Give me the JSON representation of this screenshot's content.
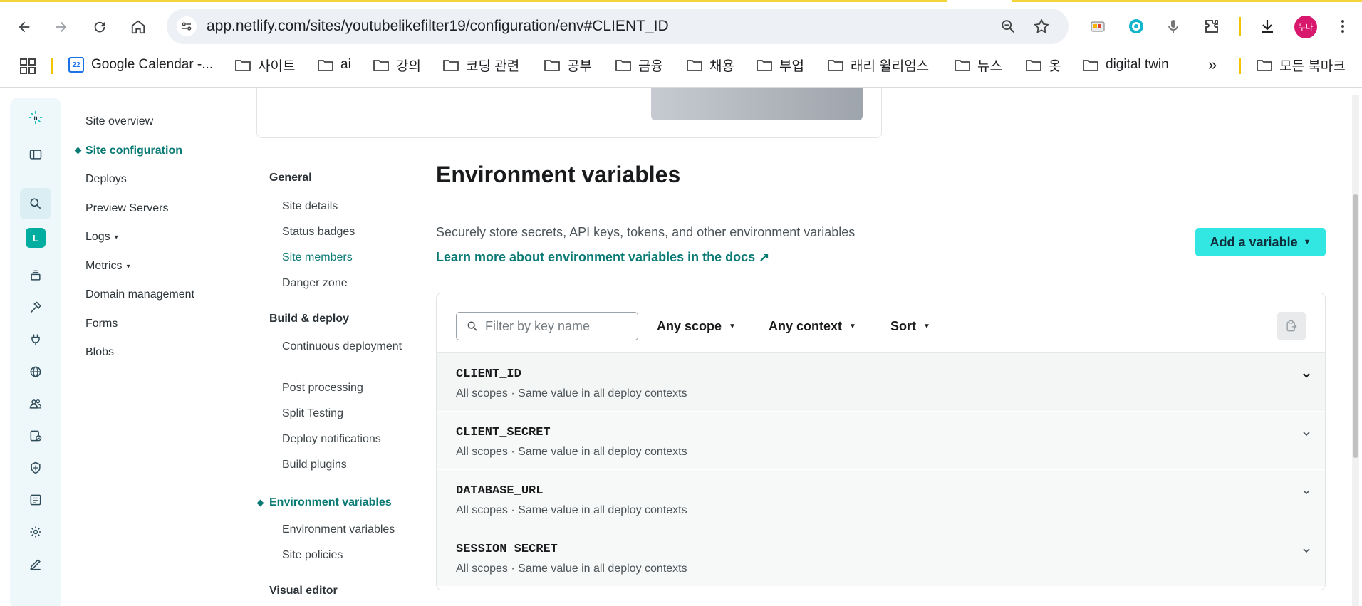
{
  "browser": {
    "url": "app.netlify.com/sites/youtubelikefilter19/configuration/env#CLIENT_ID",
    "avatar_text": "누나",
    "bookmarks": [
      {
        "label": "Google Calendar -...",
        "icon": "calendar-icon"
      },
      {
        "label": "사이트",
        "icon": "folder-icon"
      },
      {
        "label": "ai",
        "icon": "folder-icon"
      },
      {
        "label": "강의",
        "icon": "folder-icon"
      },
      {
        "label": "코딩 관련",
        "icon": "folder-icon"
      },
      {
        "label": "공부",
        "icon": "folder-icon"
      },
      {
        "label": "금융",
        "icon": "folder-icon"
      },
      {
        "label": "채용",
        "icon": "folder-icon"
      },
      {
        "label": "부업",
        "icon": "folder-icon"
      },
      {
        "label": "래리 윌리엄스",
        "icon": "folder-icon"
      },
      {
        "label": "뉴스",
        "icon": "folder-icon"
      },
      {
        "label": "옷",
        "icon": "folder-icon"
      },
      {
        "label": "digital twin",
        "icon": "folder-icon"
      }
    ],
    "overflow_label": "»",
    "all_bookmarks": "모든 북마크",
    "calendar_day": "22"
  },
  "rail": {
    "logo": "n",
    "team_initial": "L"
  },
  "sidenav": {
    "items": [
      {
        "label": "Site overview"
      },
      {
        "label": "Site configuration",
        "active": true
      },
      {
        "label": "Deploys"
      },
      {
        "label": "Preview Servers"
      },
      {
        "label": "Logs",
        "caret": "▾"
      },
      {
        "label": "Metrics",
        "caret": "▾"
      },
      {
        "label": "Domain management"
      },
      {
        "label": "Forms"
      },
      {
        "label": "Blobs"
      }
    ]
  },
  "subnav": {
    "general": "General",
    "general_links": [
      "Site details",
      "Status badges",
      "Site members",
      "Danger zone"
    ],
    "build": "Build & deploy",
    "build_links": [
      "Continuous deployment",
      "Post processing",
      "Split Testing",
      "Deploy notifications",
      "Build plugins"
    ],
    "env": "Environment variables",
    "env_links": [
      "Environment variables",
      "Site policies"
    ],
    "visual": "Visual editor"
  },
  "main": {
    "title": "Environment variables",
    "description": "Securely store secrets, API keys, tokens, and other environment variables",
    "doc_link": "Learn more about environment variables in the docs ↗",
    "add_button": "Add a variable",
    "filter_placeholder": "Filter by key name",
    "scope_dropdown": "Any scope",
    "context_dropdown": "Any context",
    "sort_dropdown": "Sort",
    "variables": [
      {
        "key": "CLIENT_ID",
        "meta": "All scopes  ·  Same value in all deploy contexts"
      },
      {
        "key": "CLIENT_SECRET",
        "meta": "All scopes  ·  Same value in all deploy contexts"
      },
      {
        "key": "DATABASE_URL",
        "meta": "All scopes  ·  Same value in all deploy contexts"
      },
      {
        "key": "SESSION_SECRET",
        "meta": "All scopes  ·  Same value in all deploy contexts"
      }
    ]
  },
  "colors": {
    "accent": "#0a7a74",
    "button": "#32e6e2",
    "rail_bg": "#eef8fb"
  }
}
